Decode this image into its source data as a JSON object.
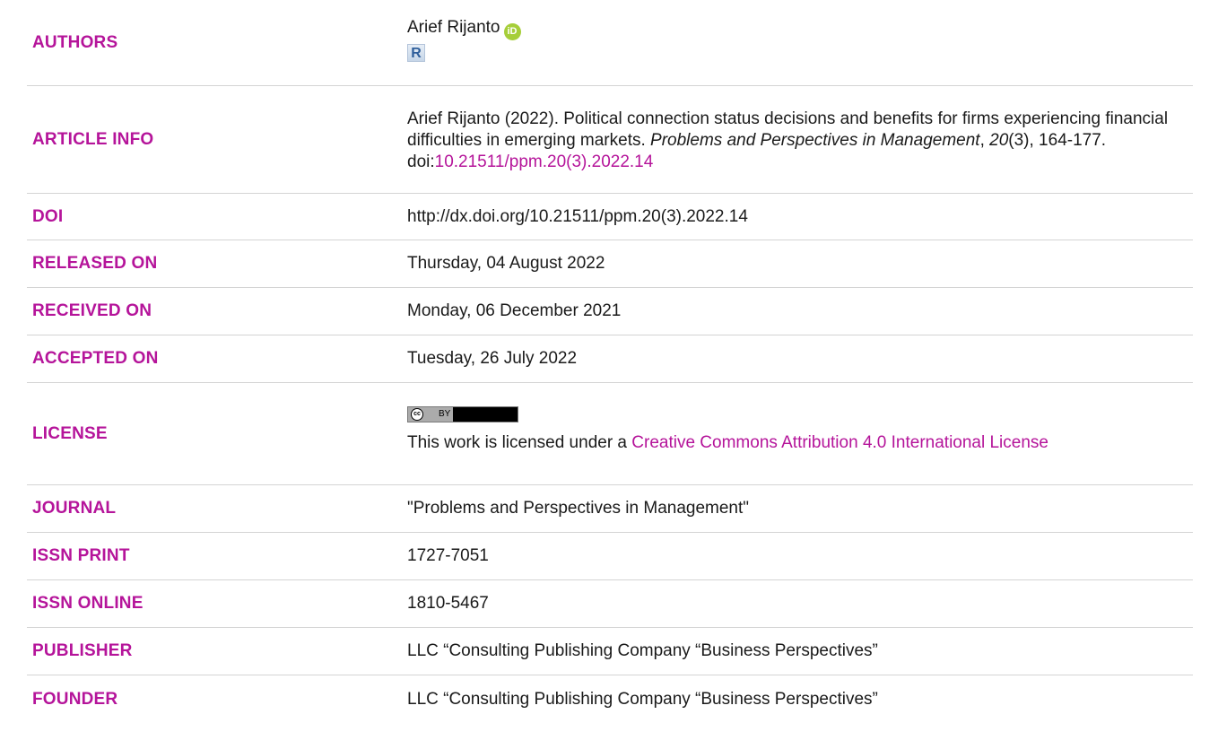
{
  "labels": {
    "authors": "AUTHORS",
    "article_info": "ARTICLE INFO",
    "doi": "DOI",
    "released_on": "RELEASED ON",
    "received_on": "RECEIVED ON",
    "accepted_on": "ACCEPTED ON",
    "license": "LICENSE",
    "journal": "JOURNAL",
    "issn_print": "ISSN PRINT",
    "issn_online": "ISSN ONLINE",
    "publisher": "PUBLISHER",
    "founder": "FOUNDER"
  },
  "authors": {
    "name": "Arief Rijanto",
    "orcid_icon": "iD",
    "researcher_icon": "R"
  },
  "article_info": {
    "citation_main": "Arief Rijanto (2022). Political connection status decisions and benefits for firms experiencing financial difficulties in emerging markets. ",
    "journal_italic": "Problems and Perspectives in Management",
    "sep1": ", ",
    "volume_italic": "20",
    "issue_pages": "(3), 164-177. doi:",
    "doi_link": "10.21511/ppm.20(3).2022.14"
  },
  "doi": "http://dx.doi.org/10.21511/ppm.20(3).2022.14",
  "released_on": "Thursday, 04 August 2022",
  "received_on": "Monday, 06 December 2021",
  "accepted_on": "Tuesday, 26 July 2022",
  "license": {
    "badge_cc": "cc",
    "badge_by": "BY",
    "text": "This work is licensed under a ",
    "link": "Creative Commons Attribution 4.0 International License"
  },
  "journal": "\"Problems and Perspectives in Management\"",
  "issn_print": "1727-7051",
  "issn_online": "1810-5467",
  "publisher": "LLC “Consulting Publishing Company “Business Perspectives”",
  "founder": "LLC “Consulting Publishing Company “Business Perspectives”",
  "colors": {
    "accent": "#b5149a",
    "divider": "#d4d4d4",
    "orcid": "#a6ce39"
  }
}
